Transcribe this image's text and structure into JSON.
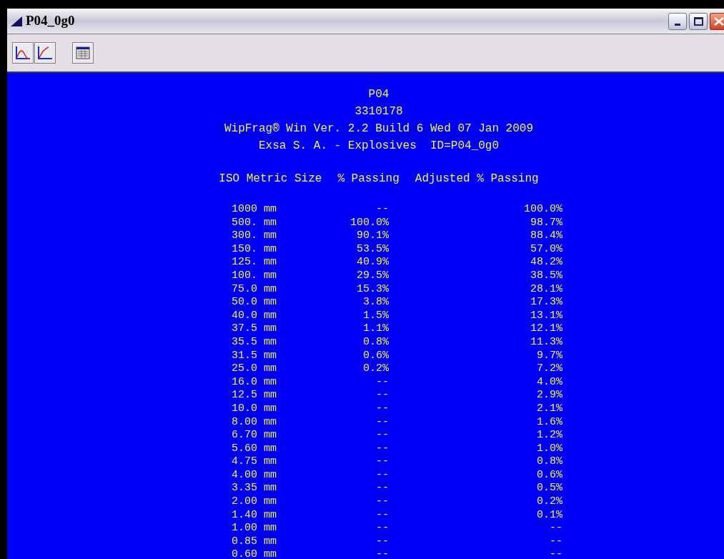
{
  "window": {
    "title": "P04_0g0"
  },
  "report": {
    "header": [
      "P04",
      "3310178",
      "WipFrag® Win Ver. 2.2 Build 6 Wed 07 Jan 2009",
      "Exsa S. A. - Explosives  ID=P04_0g0"
    ],
    "columns": [
      "ISO Metric Size",
      "% Passing",
      "Adjusted % Passing"
    ],
    "rows": [
      [
        "1000 mm",
        "--",
        "100.0%"
      ],
      [
        "500. mm",
        "100.0%",
        "98.7%"
      ],
      [
        "300. mm",
        "90.1%",
        "88.4%"
      ],
      [
        "150. mm",
        "53.5%",
        "57.0%"
      ],
      [
        "125. mm",
        "40.9%",
        "48.2%"
      ],
      [
        "100. mm",
        "29.5%",
        "38.5%"
      ],
      [
        "75.0 mm",
        "15.3%",
        "28.1%"
      ],
      [
        "50.0 mm",
        "3.8%",
        "17.3%"
      ],
      [
        "40.0 mm",
        "1.5%",
        "13.1%"
      ],
      [
        "37.5 mm",
        "1.1%",
        "12.1%"
      ],
      [
        "35.5 mm",
        "0.8%",
        "11.3%"
      ],
      [
        "31.5 mm",
        "0.6%",
        "9.7%"
      ],
      [
        "25.0 mm",
        "0.2%",
        "7.2%"
      ],
      [
        "16.0 mm",
        "--",
        "4.0%"
      ],
      [
        "12.5 mm",
        "--",
        "2.9%"
      ],
      [
        "10.0 mm",
        "--",
        "2.1%"
      ],
      [
        "8.00 mm",
        "--",
        "1.6%"
      ],
      [
        "6.70 mm",
        "--",
        "1.2%"
      ],
      [
        "5.60 mm",
        "--",
        "1.0%"
      ],
      [
        "4.75 mm",
        "--",
        "0.8%"
      ],
      [
        "4.00 mm",
        "--",
        "0.6%"
      ],
      [
        "3.35 mm",
        "--",
        "0.5%"
      ],
      [
        "2.00 mm",
        "--",
        "0.2%"
      ],
      [
        "1.40 mm",
        "--",
        "0.1%"
      ],
      [
        "1.00 mm",
        "--",
        "--"
      ],
      [
        "0.85 mm",
        "--",
        "--"
      ],
      [
        "0.60 mm",
        "--",
        "--"
      ]
    ]
  }
}
